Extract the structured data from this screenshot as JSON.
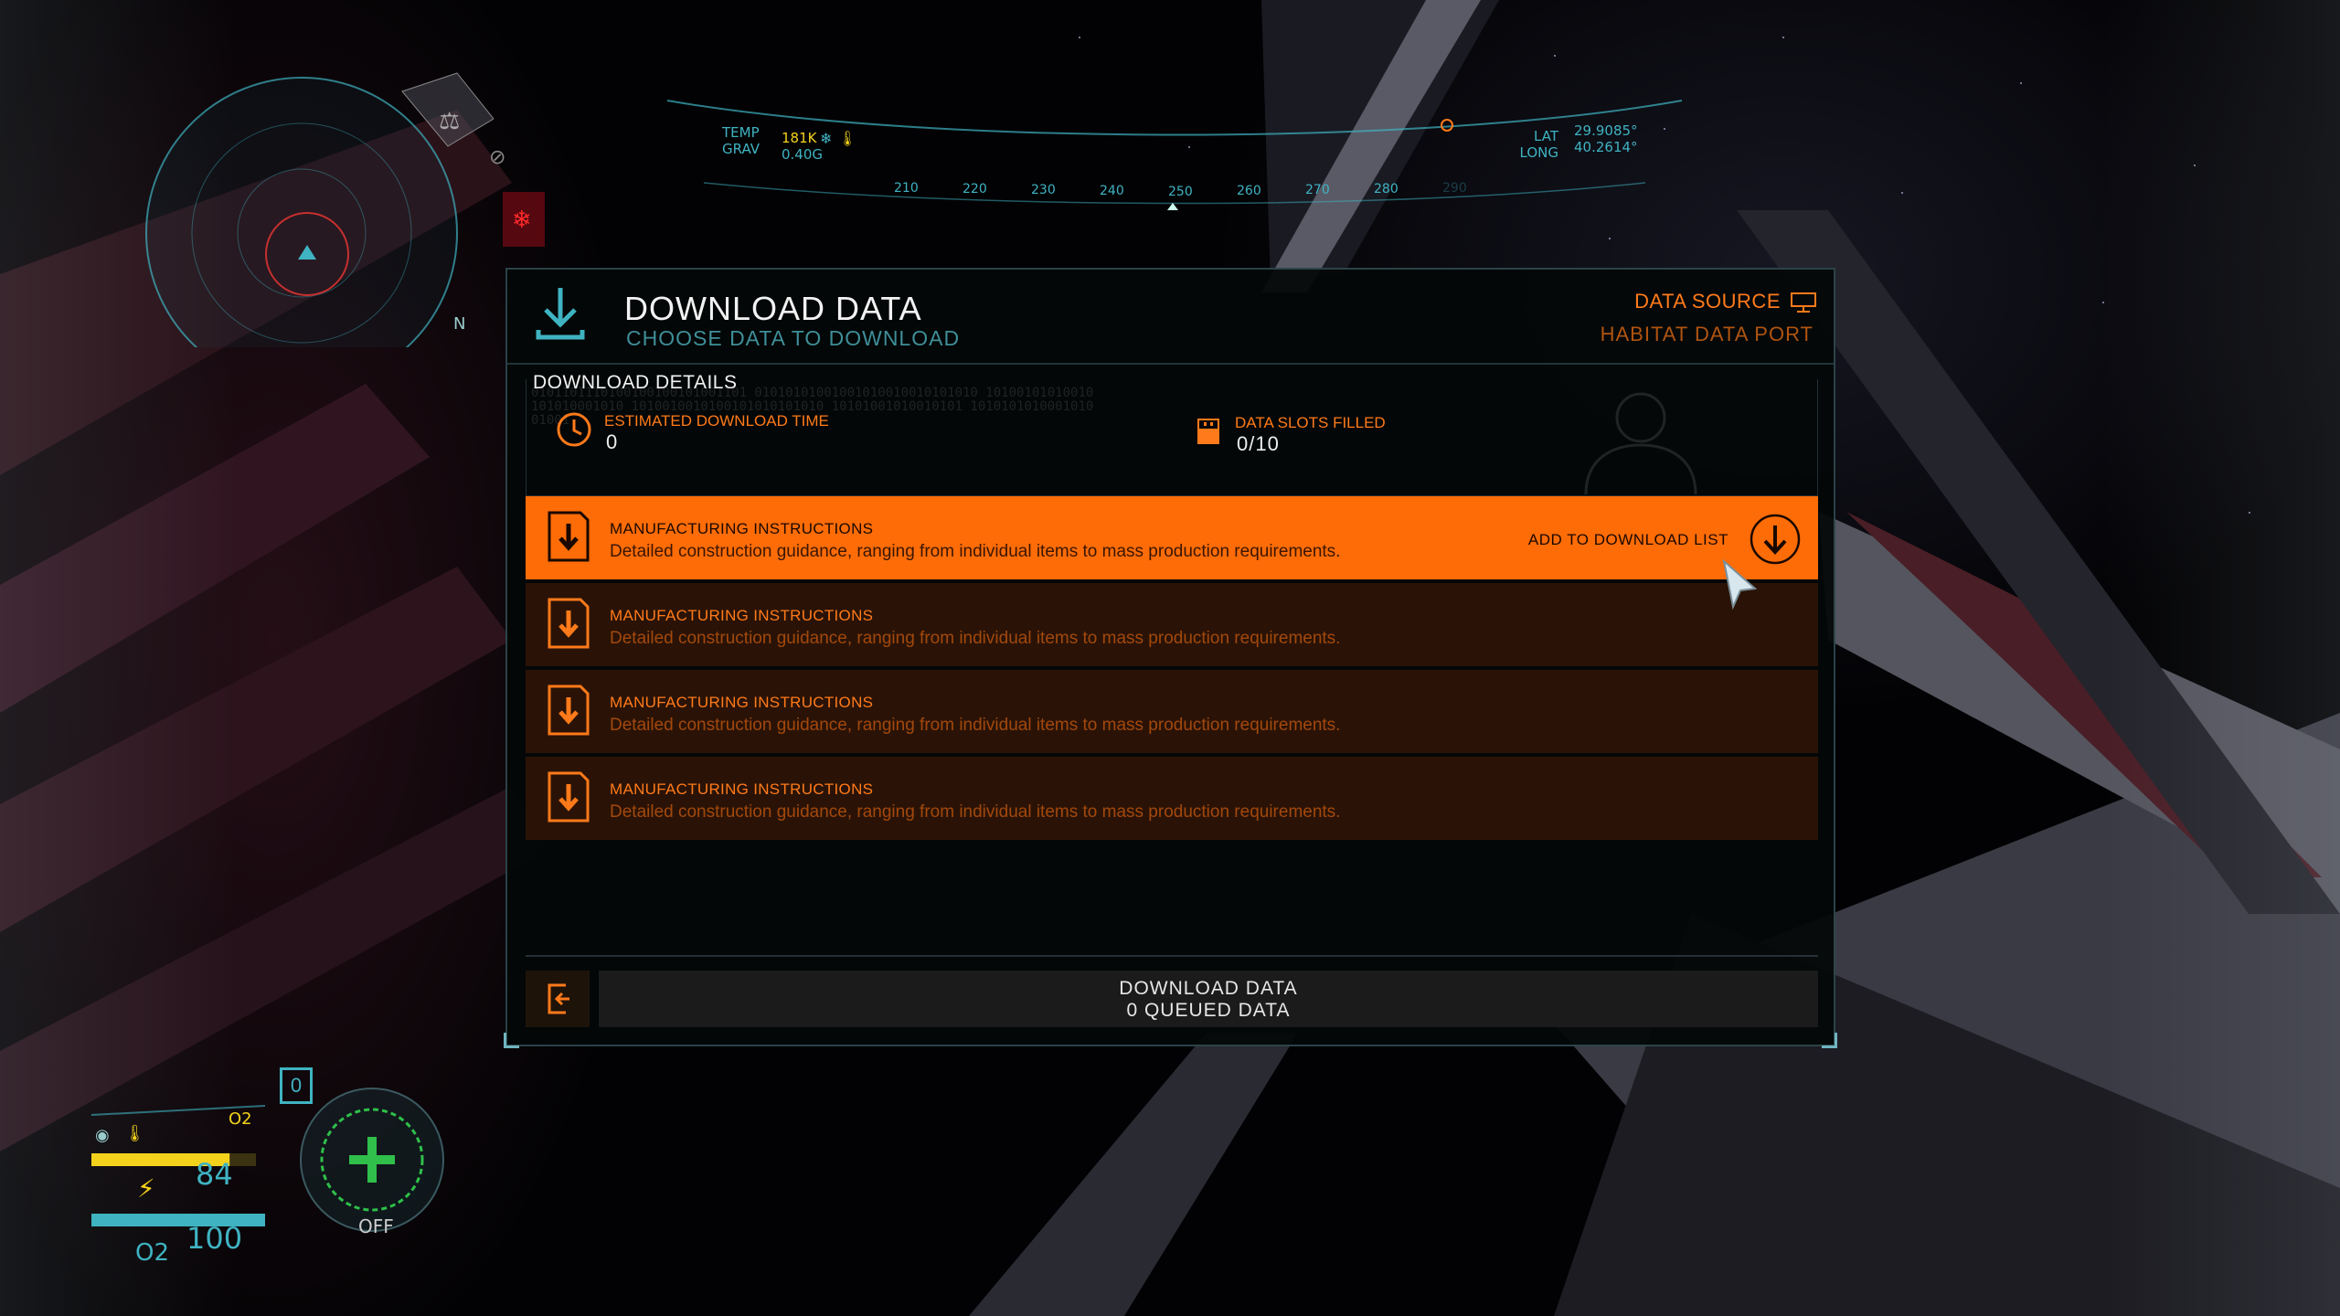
{
  "panel": {
    "title": "DOWNLOAD DATA",
    "subtitle": "CHOOSE DATA TO DOWNLOAD",
    "data_source_label": "DATA SOURCE",
    "data_source_value": "HABITAT DATA PORT",
    "icon": "download-icon",
    "details": {
      "heading": "DOWNLOAD DETAILS",
      "binary_text": "0101101110100100100101001101 01010101001001010010010101010 10100101010010101010001010 1010010010100101010101010 10101001010010101 101010101000101001001",
      "estimated_time_label": "ESTIMATED DOWNLOAD TIME",
      "estimated_time_value": "0",
      "slots_label": "DATA SLOTS FILLED",
      "slots_value": "0/10"
    },
    "items": [
      {
        "title": "MANUFACTURING INSTRUCTIONS",
        "desc": "Detailed construction guidance, ranging from individual items to mass production requirements.",
        "selected": true,
        "action": "ADD TO DOWNLOAD LIST"
      },
      {
        "title": "MANUFACTURING INSTRUCTIONS",
        "desc": "Detailed construction guidance, ranging from individual items to mass production requirements.",
        "selected": false
      },
      {
        "title": "MANUFACTURING INSTRUCTIONS",
        "desc": "Detailed construction guidance, ranging from individual items to mass production requirements.",
        "selected": false
      },
      {
        "title": "MANUFACTURING INSTRUCTIONS",
        "desc": "Detailed construction guidance, ranging from individual items to mass production requirements.",
        "selected": false
      }
    ],
    "download_button": {
      "line1": "DOWNLOAD DATA",
      "line2": "0 QUEUED DATA"
    }
  },
  "hud": {
    "temp_label": "TEMP",
    "temp_value": "181K",
    "grav_label": "GRAV",
    "grav_value": "0.40G",
    "lat_label": "LAT",
    "lat_value": "29.9085°",
    "long_label": "LONG",
    "long_value": "40.2614°",
    "compass": [
      "210",
      "220",
      "230",
      "240",
      "250",
      "260",
      "270",
      "280",
      "290"
    ],
    "radar_n": "N",
    "health": "84",
    "oxygen": "100",
    "o2_label": "O2",
    "o2_small": "O2",
    "slot_number": "0",
    "tool_state": "OFF"
  },
  "colors": {
    "accent": "#fe6c07",
    "accent_dim": "#a3480c",
    "hud_cyan": "#3fb3c2",
    "hud_yellow": "#f4d21c",
    "hud_green": "#2fbf4a"
  }
}
